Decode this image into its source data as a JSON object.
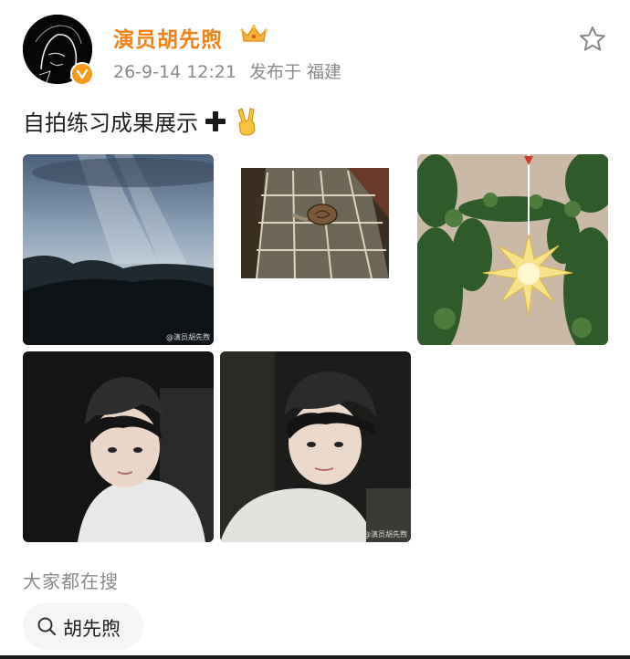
{
  "post": {
    "author": {
      "name": "演员胡先煦"
    },
    "meta": {
      "time": "26-9-14 12:21",
      "location": "发布于 福建"
    },
    "caption": {
      "text": "自拍练习成果展示"
    },
    "photos": [
      {
        "watermark": "@演员胡先煦"
      },
      {
        "watermark": ""
      },
      {
        "watermark": ""
      },
      {
        "watermark": ""
      },
      {
        "watermark": "@演员胡先煦"
      }
    ]
  },
  "trending": {
    "title": "大家都在搜",
    "chips": [
      {
        "label": "胡先煦"
      }
    ]
  },
  "colors": {
    "username": "#f08218",
    "meta": "#8a8a8a",
    "chip_bg": "#f5f5f5"
  },
  "icons": [
    "crown-icon",
    "star-icon",
    "plus-icon",
    "victory-hand-icon",
    "verified-icon",
    "search-icon"
  ]
}
